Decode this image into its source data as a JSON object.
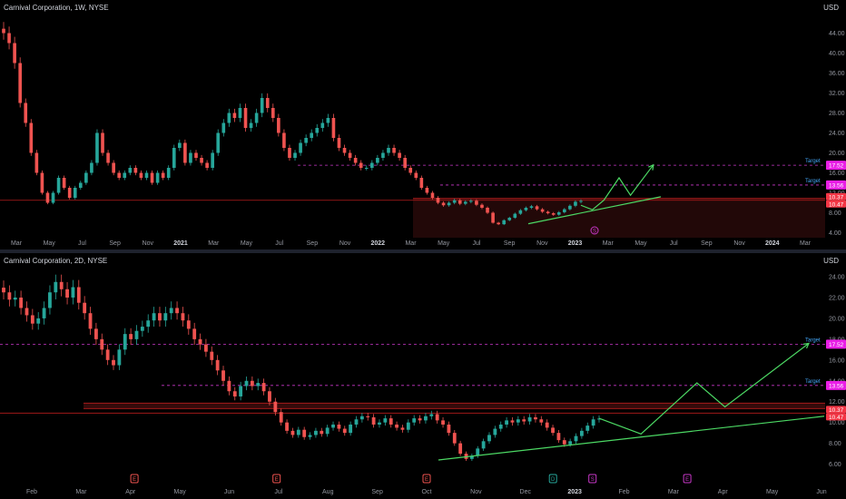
{
  "colors": {
    "background": "#000000",
    "up": "#26a69a",
    "down": "#ef5350",
    "projection": "#4cd964",
    "target_line": "#c837c8",
    "target_badge": "#e91ee6",
    "price_badge": "#f23645",
    "tick_text": "#9598a1",
    "axis_text_bold": "#d1d4dc",
    "resistance": "#b71c1c"
  },
  "chart_data": [
    {
      "type": "candlestick",
      "title": "Carnival Corporation, 1W, NYSE",
      "currency": "USD",
      "y_ticks": [
        "4.00",
        "8.00",
        "12.00",
        "16.00",
        "20.00",
        "24.00",
        "28.00",
        "32.00",
        "36.00",
        "40.00",
        "44.00"
      ],
      "x_ticks": [
        {
          "label": "Mar",
          "bold": false
        },
        {
          "label": "May",
          "bold": false
        },
        {
          "label": "Jul",
          "bold": false
        },
        {
          "label": "Sep",
          "bold": false
        },
        {
          "label": "Nov",
          "bold": false
        },
        {
          "label": "2021",
          "bold": true
        },
        {
          "label": "Mar",
          "bold": false
        },
        {
          "label": "May",
          "bold": false
        },
        {
          "label": "Jul",
          "bold": false
        },
        {
          "label": "Sep",
          "bold": false
        },
        {
          "label": "Nov",
          "bold": false
        },
        {
          "label": "2022",
          "bold": true
        },
        {
          "label": "Mar",
          "bold": false
        },
        {
          "label": "May",
          "bold": false
        },
        {
          "label": "Jul",
          "bold": false
        },
        {
          "label": "Sep",
          "bold": false
        },
        {
          "label": "Nov",
          "bold": false
        },
        {
          "label": "2023",
          "bold": true
        },
        {
          "label": "Mar",
          "bold": false
        },
        {
          "label": "May",
          "bold": false
        },
        {
          "label": "Jul",
          "bold": false
        },
        {
          "label": "Sep",
          "bold": false
        },
        {
          "label": "Nov",
          "bold": false
        },
        {
          "label": "2024",
          "bold": true
        },
        {
          "label": "Mar",
          "bold": false
        }
      ],
      "target_lines": [
        {
          "label": "Target",
          "value": 17.52,
          "badge": "17.52"
        },
        {
          "label": "Target",
          "value": 13.56,
          "badge": "13.56"
        }
      ],
      "price_badges": [
        "10.37",
        "10.47"
      ],
      "resistance_value": 10.5,
      "closes": [
        44,
        42,
        38,
        30,
        26,
        20,
        16,
        12,
        10,
        12,
        15,
        13,
        11,
        13,
        14,
        16,
        18,
        24,
        20,
        18,
        16,
        15,
        16,
        17,
        16,
        15,
        16,
        14,
        16,
        15,
        17,
        21,
        22,
        18,
        20,
        19,
        18,
        17,
        20,
        24,
        26,
        28,
        27,
        29,
        25,
        26,
        28,
        31,
        29,
        27,
        24,
        21,
        19,
        20,
        22,
        23,
        24,
        25,
        26,
        27,
        23,
        21,
        20,
        19,
        18,
        17,
        17,
        18,
        19,
        20,
        21,
        20,
        19,
        17,
        16,
        15,
        13,
        12,
        11,
        10,
        9.5,
        10,
        10.5,
        9.8,
        10.2,
        10.4,
        9.6,
        9,
        8,
        6,
        5.7,
        6.5,
        7,
        7.8,
        8.5,
        9,
        9.3,
        8.7,
        8.2,
        7.9,
        7.6,
        8.1,
        8.7,
        9.4,
        10.2,
        10.37
      ],
      "projection_path": [
        [
          0,
          9.5
        ],
        [
          6,
          8.6
        ],
        [
          12,
          10.5
        ],
        [
          20,
          15
        ],
        [
          26,
          11.5
        ],
        [
          38,
          17.6
        ]
      ],
      "trendline": [
        [
          0,
          5.8
        ],
        [
          60,
          11.2
        ]
      ]
    },
    {
      "type": "candlestick",
      "title": "Carnival Corporation, 2D, NYSE",
      "currency": "USD",
      "y_ticks": [
        "6.00",
        "8.00",
        "10.00",
        "12.00",
        "14.00",
        "16.00",
        "18.00",
        "20.00",
        "22.00",
        "24.00"
      ],
      "x_ticks": [
        {
          "label": "Feb",
          "bold": false
        },
        {
          "label": "Mar",
          "bold": false
        },
        {
          "label": "Apr",
          "bold": false
        },
        {
          "label": "May",
          "bold": false
        },
        {
          "label": "Jun",
          "bold": false
        },
        {
          "label": "Jul",
          "bold": false
        },
        {
          "label": "Aug",
          "bold": false
        },
        {
          "label": "Sep",
          "bold": false
        },
        {
          "label": "Oct",
          "bold": false
        },
        {
          "label": "Nov",
          "bold": false
        },
        {
          "label": "Dec",
          "bold": false
        },
        {
          "label": "2023",
          "bold": true
        },
        {
          "label": "Feb",
          "bold": false
        },
        {
          "label": "Mar",
          "bold": false
        },
        {
          "label": "Apr",
          "bold": false
        },
        {
          "label": "May",
          "bold": false
        },
        {
          "label": "Jun",
          "bold": false
        }
      ],
      "target_lines": [
        {
          "label": "Target",
          "value": 17.52,
          "badge": "17.52"
        },
        {
          "label": "Target",
          "value": 13.56,
          "badge": "13.56"
        }
      ],
      "price_badges": [
        "10.37",
        "10.47"
      ],
      "resistance_value": 10.9,
      "closes": [
        22.5,
        21.8,
        22,
        21,
        20.3,
        19.5,
        20,
        21,
        22.5,
        23.5,
        22.8,
        22,
        23,
        21.5,
        20.5,
        19,
        18,
        17,
        16,
        15.5,
        17,
        18.5,
        18,
        18.8,
        19.2,
        19.8,
        20.5,
        19.8,
        20.5,
        21,
        20.5,
        19.8,
        19,
        18,
        17.5,
        16.8,
        16,
        15,
        14,
        13,
        12.5,
        13.5,
        14,
        13.5,
        13.8,
        13,
        12,
        11,
        10,
        9.2,
        8.8,
        9.3,
        8.6,
        8.8,
        9.2,
        8.9,
        9.5,
        9.8,
        9.4,
        9,
        9.8,
        10.3,
        10.6,
        10.5,
        9.8,
        10,
        10.4,
        9.8,
        9.5,
        9.3,
        10,
        10.4,
        10.2,
        10.6,
        10.8,
        10.2,
        9.8,
        9,
        8,
        7,
        6.5,
        6.8,
        7.5,
        8.2,
        8.8,
        9.4,
        9.8,
        10.2,
        10,
        10.3,
        10.1,
        10.5,
        10.3,
        10,
        9.5,
        9,
        8.3,
        7.9,
        8.2,
        8.7,
        9.2,
        9.7,
        10.3,
        10.37
      ],
      "projection_path": [
        [
          0,
          10.4
        ],
        [
          6,
          8.9
        ],
        [
          14,
          13.8
        ],
        [
          18,
          11.5
        ],
        [
          30,
          17.6
        ]
      ],
      "trendline": [
        [
          0,
          6.4
        ],
        [
          60,
          10.6
        ]
      ],
      "events": [
        {
          "letter": "E",
          "color": "#ef5350",
          "pos": 0.13
        },
        {
          "letter": "E",
          "color": "#ef5350",
          "pos": 0.31
        },
        {
          "letter": "E",
          "color": "#ef5350",
          "pos": 0.5
        },
        {
          "letter": "D",
          "color": "#26a69a",
          "pos": 0.66
        },
        {
          "letter": "S",
          "color": "#c837c8",
          "pos": 0.71
        },
        {
          "letter": "E",
          "color": "#c837c8",
          "pos": 0.83
        }
      ]
    }
  ],
  "weekly_event": {
    "letter": "S",
    "color": "#c837c8"
  }
}
